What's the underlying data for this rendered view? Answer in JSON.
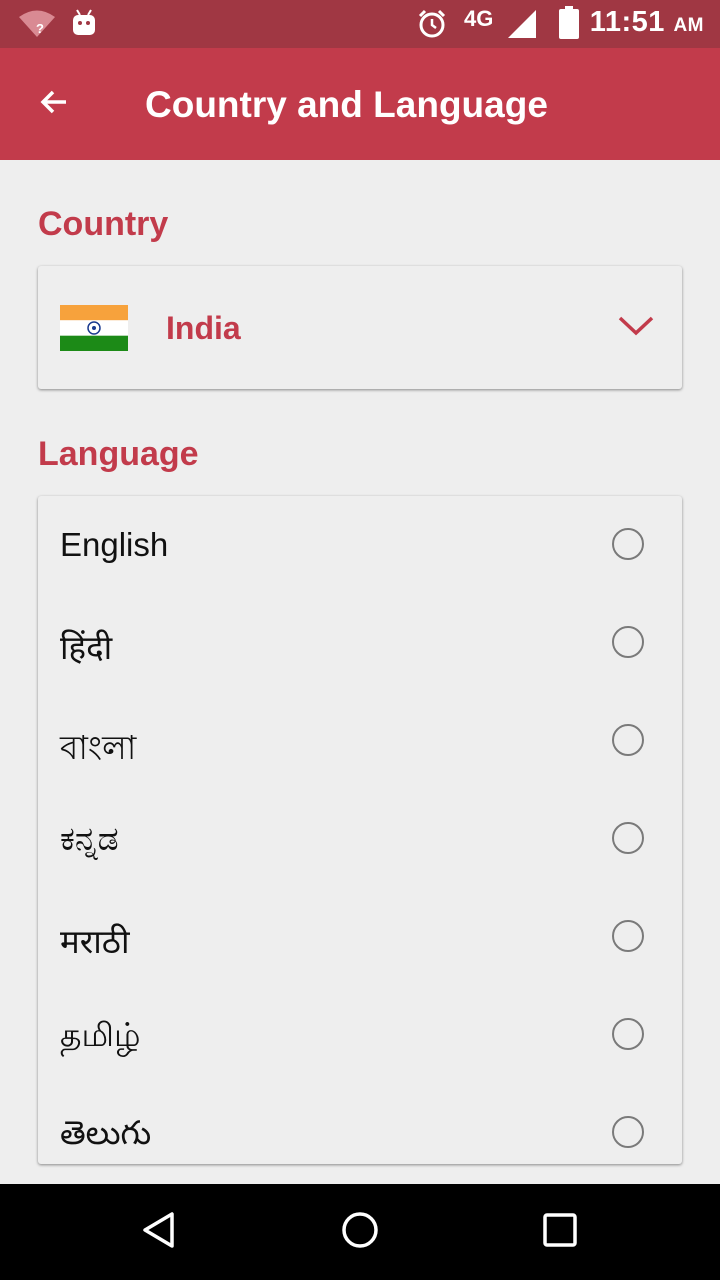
{
  "status_bar": {
    "network_label": "4G",
    "time": "11:51",
    "ampm": "AM",
    "icons": [
      "wifi-unknown-icon",
      "android-debug-icon",
      "alarm-icon",
      "signal-icon",
      "battery-icon"
    ]
  },
  "app_bar": {
    "title": "Country and Language",
    "back_icon": "arrow-back-icon"
  },
  "country_section": {
    "label": "Country",
    "selected_country": "India",
    "flag_icon": "india-flag-icon"
  },
  "language_section": {
    "label": "Language",
    "options": [
      {
        "label": "English",
        "selected": false
      },
      {
        "label": "हिंदी",
        "selected": false
      },
      {
        "label": "বাংলা",
        "selected": false
      },
      {
        "label": "ಕನ್ನಡ",
        "selected": false
      },
      {
        "label": "मराठी",
        "selected": false
      },
      {
        "label": "தமிழ்",
        "selected": false
      },
      {
        "label": "తెలుగు",
        "selected": false
      }
    ]
  },
  "nav_bar": {
    "icons": [
      "back-triangle-icon",
      "home-circle-icon",
      "recents-square-icon"
    ]
  },
  "colors": {
    "accent": "#c23b4b",
    "status_bar": "#a03743",
    "background": "#eeeeee"
  }
}
